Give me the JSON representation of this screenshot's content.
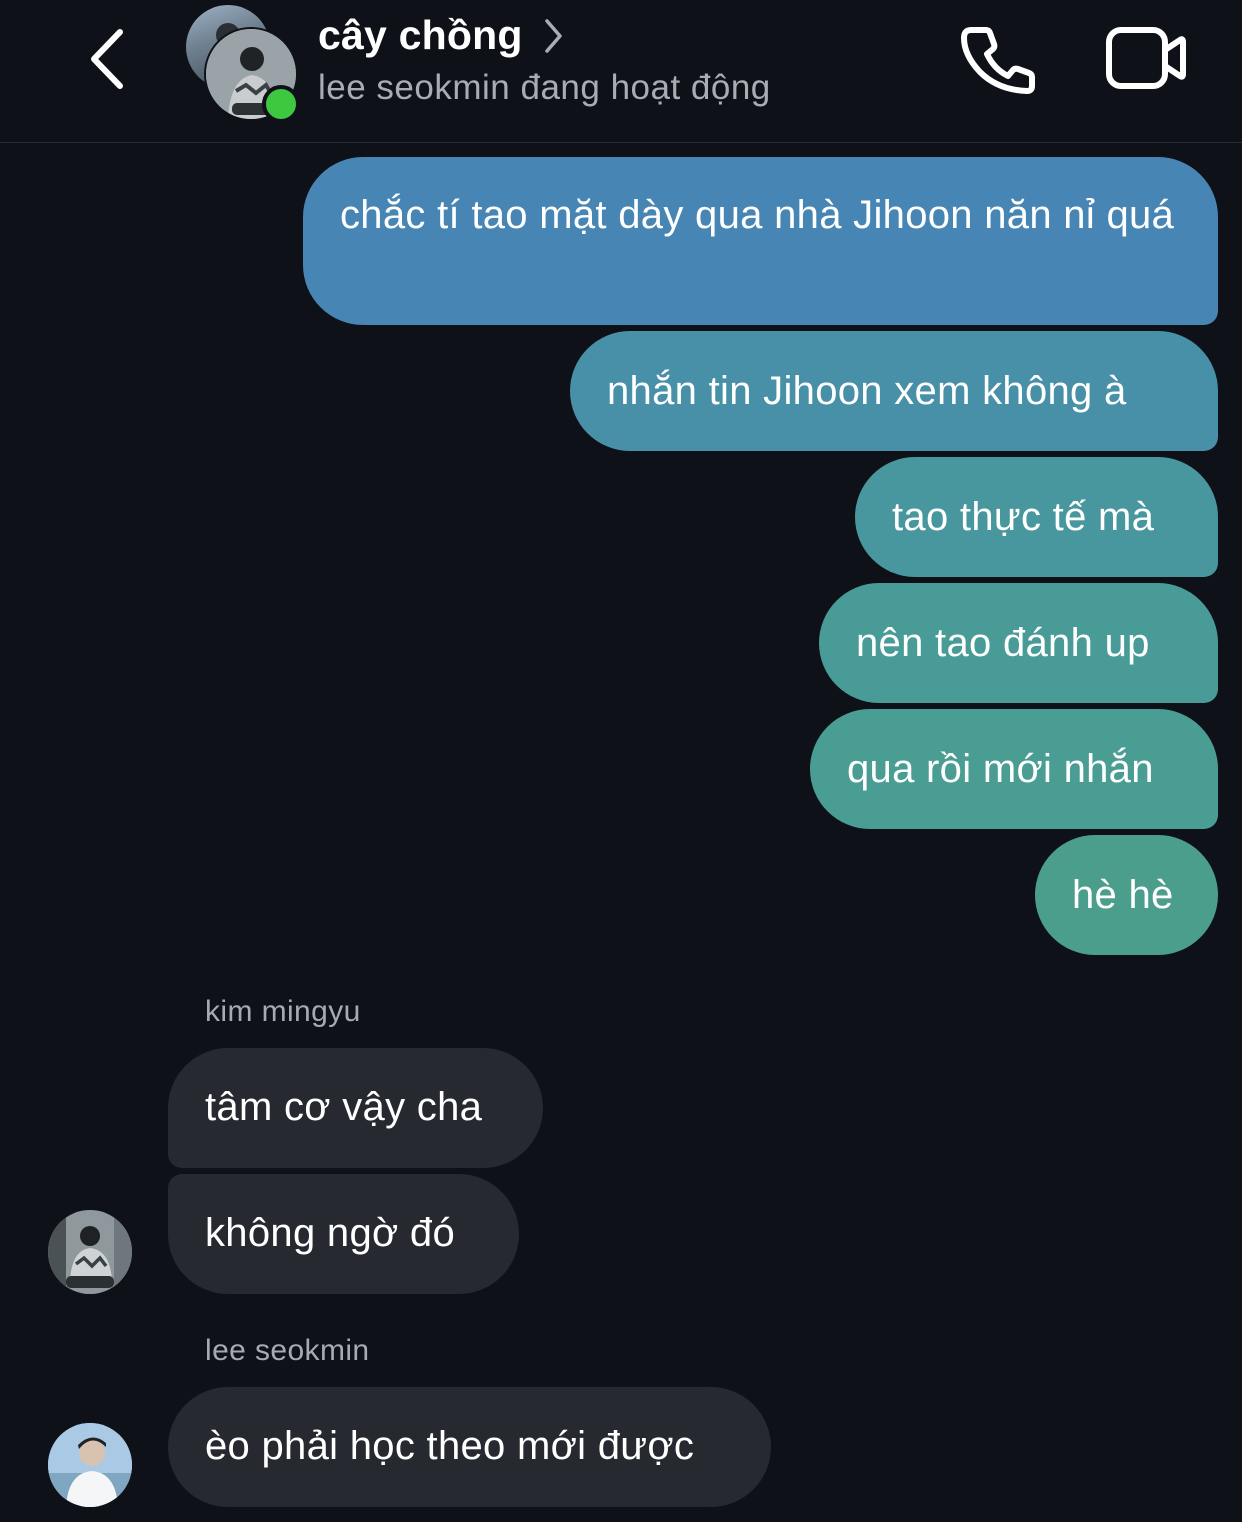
{
  "header": {
    "title": "cây chồng",
    "status": "lee seokmin đang hoạt động",
    "colors": {
      "background": "#0e1117",
      "online_dot": "#3ec83f"
    },
    "icons": [
      "back-arrow-icon",
      "chevron-right-icon",
      "phone-icon",
      "video-camera-icon"
    ]
  },
  "messages_sent": [
    {
      "text": "chắc tí tao mặt dày qua nhà Jihoon năn nỉ quá",
      "color": "#4786b4"
    },
    {
      "text": "nhắn tin Jihoon xem không à",
      "color": "#488fa8"
    },
    {
      "text": "tao thực tế mà",
      "color": "#48979f"
    },
    {
      "text": "nên tao đánh up",
      "color": "#499b98"
    },
    {
      "text": "qua rồi mới nhắn",
      "color": "#4a9d93"
    },
    {
      "text": "hè hè",
      "color": "#4c9e8c"
    }
  ],
  "group_mingyu": {
    "sender": "kim mingyu",
    "messages": [
      "tâm cơ vậy cha",
      "không ngờ đó"
    ]
  },
  "group_seokmin": {
    "sender": "lee seokmin",
    "messages": [
      "èo phải học theo mới được"
    ]
  },
  "colors": {
    "received_bubble": "#262930",
    "sender_name": "#a7abb1"
  }
}
